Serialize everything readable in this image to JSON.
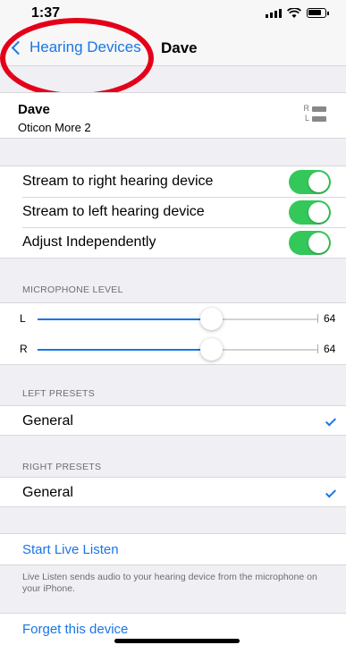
{
  "status_bar": {
    "time": "1:37",
    "icons": [
      "location-arrow-icon",
      "signal-icon",
      "wifi-icon",
      "battery-icon"
    ]
  },
  "nav": {
    "back_label": "Hearing Devices",
    "title": "Dave"
  },
  "device": {
    "name": "Dave",
    "model": "Oticon More 2",
    "battery": {
      "right_label": "R",
      "left_label": "L"
    }
  },
  "stream": {
    "items": [
      {
        "label": "Stream to right hearing device",
        "on": true
      },
      {
        "label": "Stream to left hearing device",
        "on": true
      },
      {
        "label": "Adjust Independently",
        "on": true
      }
    ]
  },
  "microphone": {
    "header": "MICROPHONE LEVEL",
    "sliders": [
      {
        "label": "L",
        "value": "64",
        "fraction": 0.62
      },
      {
        "label": "R",
        "value": "64",
        "fraction": 0.62
      }
    ]
  },
  "left_presets": {
    "header": "LEFT PRESETS",
    "selected": "General"
  },
  "right_presets": {
    "header": "RIGHT PRESETS",
    "selected": "General"
  },
  "live_listen": {
    "button": "Start Live Listen",
    "description": "Live Listen sends audio to your hearing device from the microphone on your iPhone."
  },
  "forget": {
    "button": "Forget this device"
  },
  "colors": {
    "accent": "#1a75e6",
    "toggle_on": "#34c759",
    "annotation": "#e5001a"
  }
}
